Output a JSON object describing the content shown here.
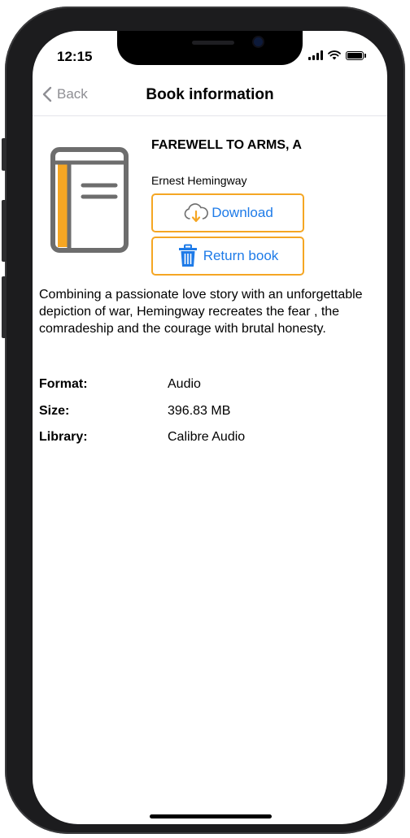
{
  "status_bar": {
    "time": "12:15"
  },
  "nav": {
    "back_label": "Back",
    "title": "Book information"
  },
  "book": {
    "title": "FAREWELL TO ARMS, A",
    "author": "Ernest Hemingway",
    "description": "Combining a passionate love story with an unforgettable depiction of war, Hemingway recreates the fear , the comradeship and the courage with brutal honesty."
  },
  "actions": {
    "download_label": "Download",
    "return_label": "Return book"
  },
  "details": [
    {
      "label": "Format:",
      "value": "Audio"
    },
    {
      "label": "Size:",
      "value": "396.83 MB"
    },
    {
      "label": "Library:",
      "value": "Calibre Audio"
    }
  ],
  "colors": {
    "accent_border": "#f5a623",
    "link_blue": "#1e7be8",
    "book_spine": "#f5a623",
    "book_gray": "#6d6d6d"
  },
  "icons": [
    "chevron-left-icon",
    "book-icon",
    "cloud-download-icon",
    "trash-icon",
    "signal-icon",
    "wifi-icon",
    "battery-icon"
  ]
}
